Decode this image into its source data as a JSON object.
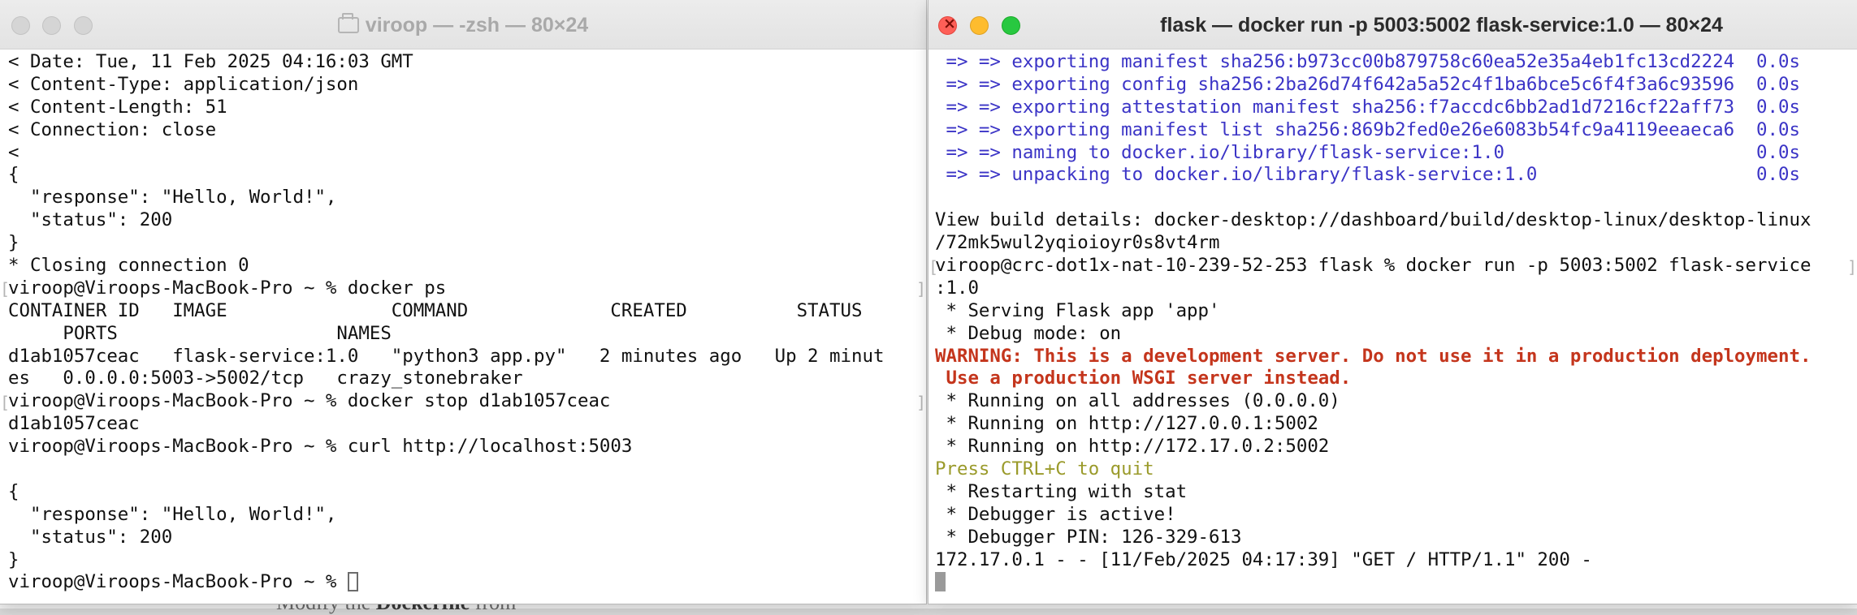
{
  "background": {
    "doc_text_prefix": "Modify the ",
    "doc_text_bold": "Dockerfile",
    "doc_text_suffix": " from"
  },
  "left_window": {
    "title": "viroop — -zsh — 80×24",
    "lines": [
      "< Date: Tue, 11 Feb 2025 04:16:03 GMT",
      "< Content-Type: application/json",
      "< Content-Length: 51",
      "< Connection: close",
      "<",
      "{",
      "  \"response\": \"Hello, World!\",",
      "  \"status\": 200",
      "}",
      "* Closing connection 0",
      "viroop@Viroops-MacBook-Pro ~ % docker ps",
      "CONTAINER ID   IMAGE               COMMAND             CREATED          STATUS",
      "     PORTS                    NAMES",
      "d1ab1057ceac   flask-service:1.0   \"python3 app.py\"   2 minutes ago   Up 2 minut",
      "es   0.0.0.0:5003->5002/tcp   crazy_stonebraker",
      "viroop@Viroops-MacBook-Pro ~ % docker stop d1ab1057ceac",
      "d1ab1057ceac",
      "viroop@Viroops-MacBook-Pro ~ % curl http://localhost:5003",
      "",
      "{",
      "  \"response\": \"Hello, World!\",",
      "  \"status\": 200",
      "}",
      "viroop@Viroops-MacBook-Pro ~ % "
    ]
  },
  "right_window": {
    "title": "flask — docker run -p 5003:5002 flask-service:1.0 — 80×24",
    "lines": [
      " => => exporting manifest sha256:b973cc00b879758c60ea52e35a4eb1fc13cd2224  0.0s",
      " => => exporting config sha256:2ba26d74f642a5a52c4f1ba6bce5c6f4f3a6c93596  0.0s",
      " => => exporting attestation manifest sha256:f7accdc6bb2ad1d7216cf22aff73  0.0s",
      " => => exporting manifest list sha256:869b2fed0e26e6083b54fc9a4119eeaeca6  0.0s",
      " => => naming to docker.io/library/flask-service:1.0                       0.0s",
      " => => unpacking to docker.io/library/flask-service:1.0                    0.0s",
      "",
      "View build details: docker-desktop://dashboard/build/desktop-linux/desktop-linux",
      "/72mk5wul2yqioioyr0s8vt4rm",
      "viroop@crc-dot1x-nat-10-239-52-253 flask % docker run -p 5003:5002 flask-service",
      ":1.0",
      " * Serving Flask app 'app'",
      " * Debug mode: on",
      "WARNING: This is a development server. Do not use it in a production deployment.",
      " Use a production WSGI server instead.",
      " * Running on all addresses (0.0.0.0)",
      " * Running on http://127.0.0.1:5002",
      " * Running on http://172.17.0.2:5002",
      "Press CTRL+C to quit",
      " * Restarting with stat",
      " * Debugger is active!",
      " * Debugger PIN: 126-329-613",
      "172.17.0.1 - - [11/Feb/2025 04:17:39] \"GET / HTTP/1.1\" 200 -",
      ""
    ]
  }
}
